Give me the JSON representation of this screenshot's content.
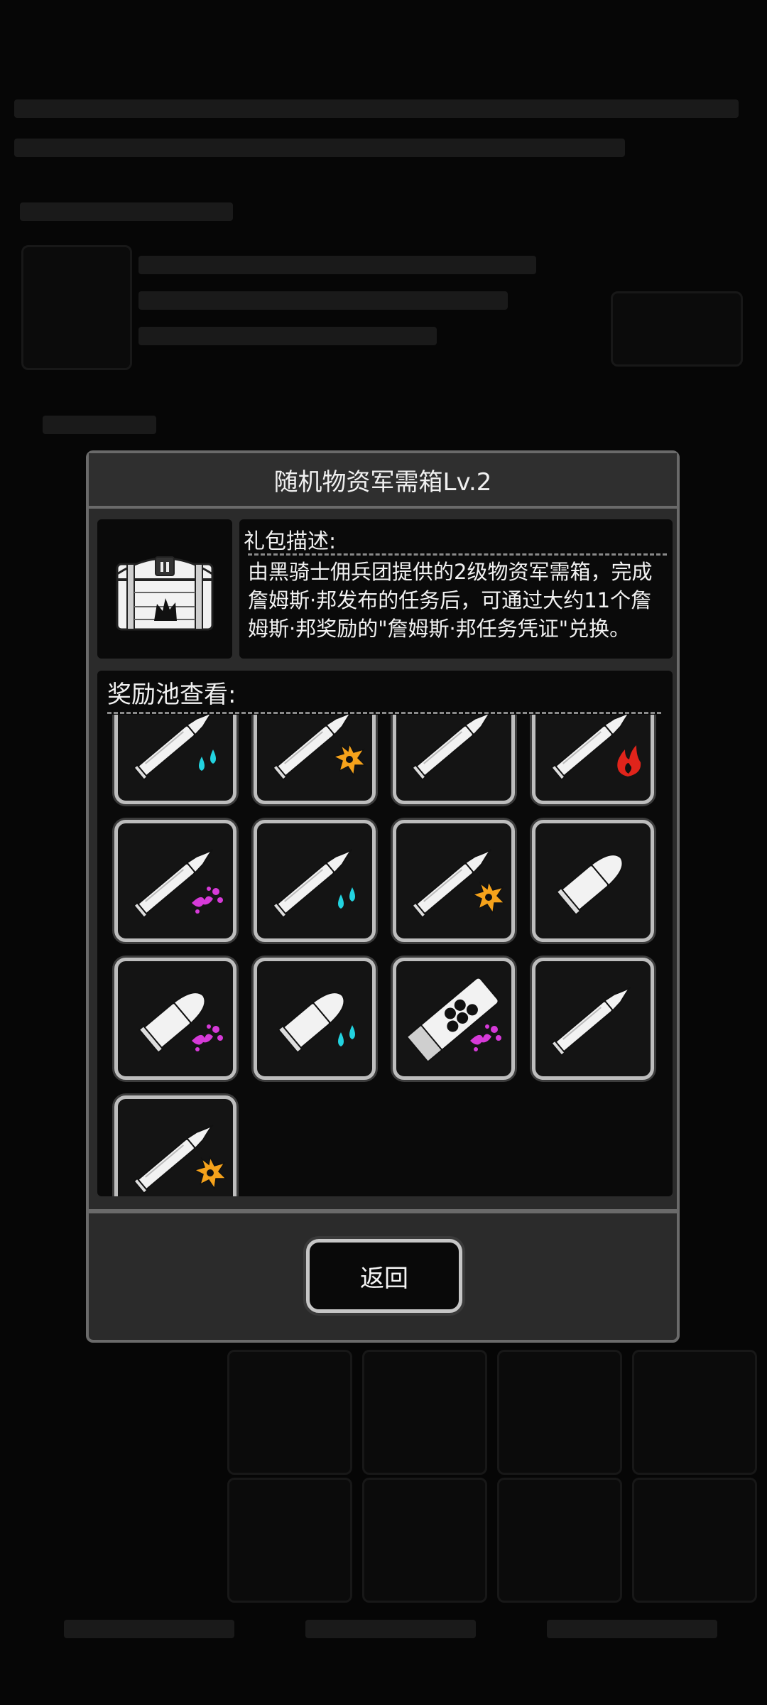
{
  "dialog": {
    "title": "随机物资军需箱Lv.2",
    "chest_icon": "supply-chest-icon",
    "description_label": "礼包描述:",
    "description_text": "由黑骑士佣兵团提供的2级物资军需箱，完成詹姆斯·邦发布的任务后，可通过大约11个詹姆斯·邦奖励的\"詹姆斯·邦任务凭证\"兑换。",
    "reward_label": "奖励池查看:",
    "back_label": "返回"
  },
  "colors": {
    "water": "#22d3e0",
    "explosive": "#f5a21b",
    "fire": "#e0241b",
    "toxic": "#d63ad8"
  },
  "rewards": [
    {
      "type": "rifle-bullet",
      "element": "water"
    },
    {
      "type": "rifle-bullet",
      "element": "explosive"
    },
    {
      "type": "rifle-bullet",
      "element": "none"
    },
    {
      "type": "rifle-bullet",
      "element": "fire"
    },
    {
      "type": "rifle-bullet",
      "element": "toxic"
    },
    {
      "type": "rifle-bullet",
      "element": "water"
    },
    {
      "type": "rifle-bullet",
      "element": "explosive"
    },
    {
      "type": "pistol-bullet",
      "element": "none"
    },
    {
      "type": "pistol-bullet",
      "element": "toxic"
    },
    {
      "type": "pistol-bullet",
      "element": "water"
    },
    {
      "type": "shotgun-shell",
      "element": "toxic"
    },
    {
      "type": "rifle-bullet",
      "element": "none"
    },
    {
      "type": "rifle-bullet",
      "element": "explosive"
    }
  ]
}
